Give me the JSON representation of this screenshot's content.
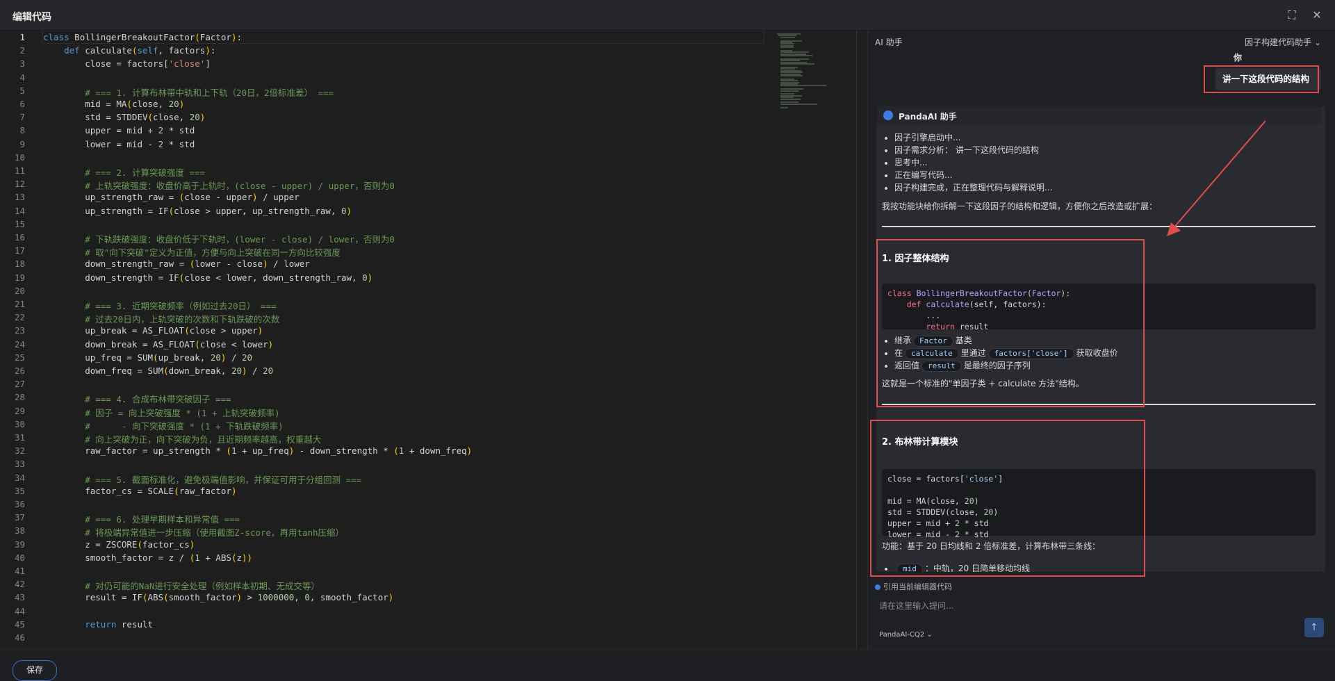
{
  "window": {
    "title": "编辑代码",
    "fullscreen_icon": "expand-icon",
    "close_icon": "close-icon"
  },
  "editor": {
    "line_numbers": [
      "1",
      "2",
      "3",
      "4",
      "5",
      "6",
      "7",
      "8",
      "9",
      "10",
      "11",
      "12",
      "13",
      "14",
      "15",
      "16",
      "17",
      "18",
      "19",
      "20",
      "21",
      "22",
      "23",
      "24",
      "25",
      "26",
      "27",
      "28",
      "29",
      "30",
      "31",
      "32",
      "33",
      "34",
      "35",
      "36",
      "37",
      "38",
      "39",
      "40",
      "41",
      "42",
      "43",
      "44",
      "45",
      "46"
    ],
    "active_line": "1",
    "lines": [
      "class BollingerBreakoutFactor(Factor):",
      "    def calculate(self, factors):",
      "        close = factors['close']",
      "",
      "        # === 1. 计算布林带中轨和上下轨（20日，2倍标准差） ===",
      "        mid = MA(close, 20)",
      "        std = STDDEV(close, 20)",
      "        upper = mid + 2 * std",
      "        lower = mid - 2 * std",
      "",
      "        # === 2. 计算突破强度 ===",
      "        # 上轨突破强度：收盘价高于上轨时，(close - upper) / upper，否则为0",
      "        up_strength_raw = (close - upper) / upper",
      "        up_strength = IF(close > upper, up_strength_raw, 0)",
      "",
      "        # 下轨跌破强度：收盘价低于下轨时，(lower - close) / lower，否则为0",
      "        # 取\"向下突破\"定义为正值，方便与向上突破在同一方向比较强度",
      "        down_strength_raw = (lower - close) / lower",
      "        down_strength = IF(close < lower, down_strength_raw, 0)",
      "",
      "        # === 3. 近期突破频率（例如过去20日） ===",
      "        # 过去20日内，上轨突破的次数和下轨跌破的次数",
      "        up_break = AS_FLOAT(close > upper)",
      "        down_break = AS_FLOAT(close < lower)",
      "        up_freq = SUM(up_break, 20) / 20",
      "        down_freq = SUM(down_break, 20) / 20",
      "",
      "        # === 4. 合成布林带突破因子 ===",
      "        # 因子 = 向上突破强度 * (1 + 上轨突破频率)",
      "        #      - 向下突破强度 * (1 + 下轨跌破频率)",
      "        # 向上突破为正，向下突破为负，且近期频率越高，权重越大",
      "        raw_factor = up_strength * (1 + up_freq) - down_strength * (1 + down_freq)",
      "",
      "        # === 5. 截面标准化，避免极端值影响，并保证可用于分组回测 ===",
      "        factor_cs = SCALE(raw_factor)",
      "",
      "        # === 6. 处理早期样本和异常值 ===",
      "        # 将极端异常值进一步压缩（使用截面Z-score，再用tanh压缩）",
      "        z = ZSCORE(factor_cs)",
      "        smooth_factor = z / (1 + ABS(z))",
      "",
      "        # 对仍可能的NaN进行安全处理（例如样本初期、无成交等）",
      "        result = IF(ABS(smooth_factor) > 1000000, 0, smooth_factor)",
      "",
      "        return result",
      ""
    ]
  },
  "footer": {
    "save_label": "保存"
  },
  "ai": {
    "header_label": "AI 助手",
    "mode_select": "因子构建代码助手 ⌄",
    "user_name": "你",
    "user_message": "讲一下这段代码的结构",
    "assistant_name": "PandaAI 助手",
    "status_items": [
      "因子引擎启动中...",
      "因子需求分析： 讲一下这段代码的结构",
      "思考中...",
      "正在编写代码...",
      "因子构建完成，正在整理代码与解释说明..."
    ],
    "intro": "我按功能块给你拆解一下这段因子的结构和逻辑，方便你之后改造或扩展：",
    "section1": {
      "title": "1. 因子整体结构",
      "bullets": [
        {
          "pre": "继承",
          "chip": "Factor",
          "post": "基类"
        },
        {
          "pre": "在",
          "chip": "calculate",
          "mid": "里通过",
          "chip2": "factors['close']",
          "post": "获取收盘价"
        },
        {
          "pre": "返回值",
          "chip": "result",
          "post": "是最终的因子序列"
        }
      ],
      "summary": "这就是一个标准的\"单因子类 + calculate 方法\"结构。"
    },
    "section2": {
      "title": "2. 布林带计算模块",
      "function_text": "功能：基于 20 日均线和 2 倍标准差，计算布林带三条线：",
      "partial_bullet": "：中轨，20 日简单移动均线",
      "partial_chip": "mid"
    },
    "ref_label": "引用当前编辑器代码",
    "input_placeholder": "请在这里输入提问...",
    "model": "PandaAI-CQ2 ⌄",
    "send_icon": "arrow-up-icon"
  },
  "colors": {
    "annotation_red": "#e24b4b",
    "accent_blue": "#3c7be8"
  }
}
